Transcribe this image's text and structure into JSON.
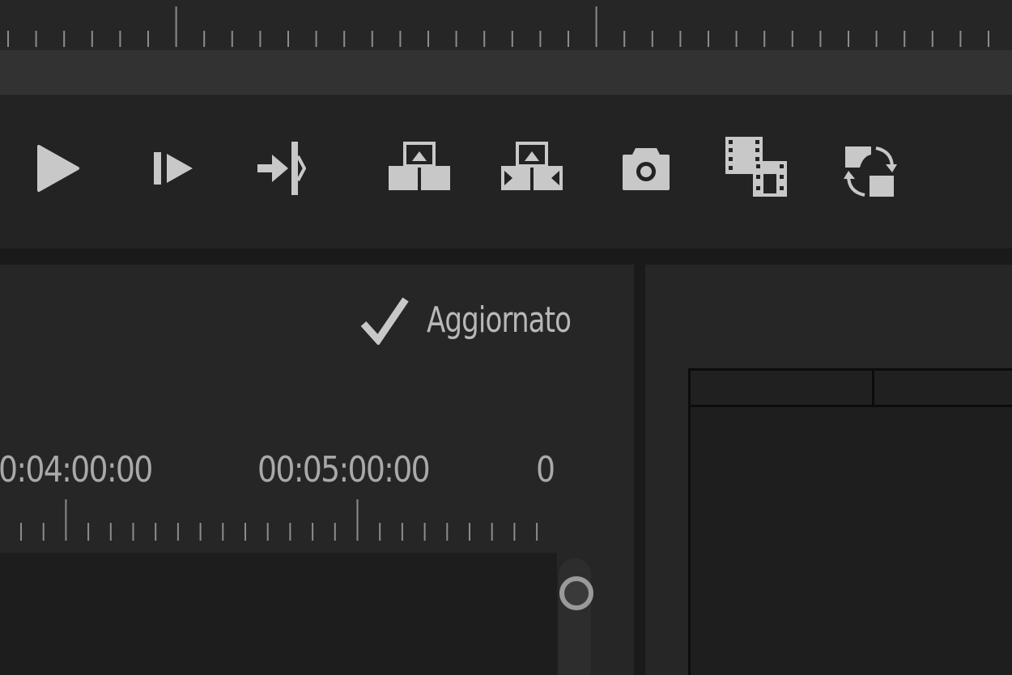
{
  "transport": {
    "buttons": [
      {
        "name": "play-button",
        "icon": "play-icon"
      },
      {
        "name": "step-forward-button",
        "icon": "step-forward-icon"
      },
      {
        "name": "go-to-out-button",
        "icon": "go-to-out-point-icon"
      },
      {
        "name": "lift-button",
        "icon": "lift-icon"
      },
      {
        "name": "extract-button",
        "icon": "extract-icon"
      },
      {
        "name": "export-frame-button",
        "icon": "camera-icon"
      },
      {
        "name": "insert-button",
        "icon": "insert-clip-icon"
      },
      {
        "name": "overwrite-button",
        "icon": "overwrite-icon"
      }
    ]
  },
  "status": {
    "label": "Aggiornato",
    "icon": "checkmark-icon"
  },
  "timeline": {
    "timecodes": [
      "0:04:00:00",
      "00:05:00:00",
      "0"
    ]
  },
  "colors": {
    "background": "#1e1e1e",
    "panel": "#262626",
    "icon": "#c8c8c8",
    "text": "#b8b8b8"
  }
}
